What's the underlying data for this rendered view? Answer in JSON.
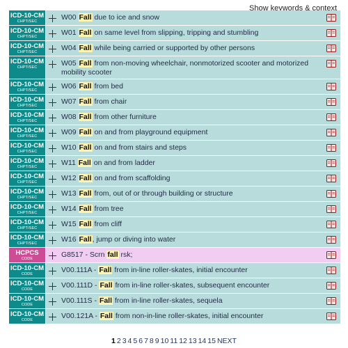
{
  "header": {
    "context_link": "Show keywords & context"
  },
  "colors": {
    "icd_badge": "#0e8a8a",
    "icd_row": "#b8dcdc",
    "hcpcs_badge": "#cc4d95",
    "hcpcs_row": "#f2cdf2",
    "keyword_highlight": "#fff3b0"
  },
  "rows": [
    {
      "system": "ICD-10-CM",
      "sub": "CHPT/SEC",
      "kind": "cm",
      "pre": "W00 ",
      "kw": "Fall",
      "post": " due to ice and snow"
    },
    {
      "system": "ICD-10-CM",
      "sub": "CHPT/SEC",
      "kind": "cm",
      "pre": "W01 ",
      "kw": "Fall",
      "post": " on same level from slipping, tripping and stumbling"
    },
    {
      "system": "ICD-10-CM",
      "sub": "CHPT/SEC",
      "kind": "cm",
      "pre": "W04 ",
      "kw": "Fall",
      "post": " while being carried or supported by other persons"
    },
    {
      "system": "ICD-10-CM",
      "sub": "CHPT/SEC",
      "kind": "cm",
      "pre": "W05 ",
      "kw": "Fall",
      "post": " from non-moving wheelchair, nonmotorized scooter and motorized mobility scooter"
    },
    {
      "system": "ICD-10-CM",
      "sub": "CHPT/SEC",
      "kind": "cm",
      "pre": "W06 ",
      "kw": "Fall",
      "post": " from bed"
    },
    {
      "system": "ICD-10-CM",
      "sub": "CHPT/SEC",
      "kind": "cm",
      "pre": "W07 ",
      "kw": "Fall",
      "post": " from chair"
    },
    {
      "system": "ICD-10-CM",
      "sub": "CHPT/SEC",
      "kind": "cm",
      "pre": "W08 ",
      "kw": "Fall",
      "post": " from other furniture"
    },
    {
      "system": "ICD-10-CM",
      "sub": "CHPT/SEC",
      "kind": "cm",
      "pre": "W09 ",
      "kw": "Fall",
      "post": " on and from playground equipment"
    },
    {
      "system": "ICD-10-CM",
      "sub": "CHPT/SEC",
      "kind": "cm",
      "pre": "W10 ",
      "kw": "Fall",
      "post": " on and from stairs and steps"
    },
    {
      "system": "ICD-10-CM",
      "sub": "CHPT/SEC",
      "kind": "cm",
      "pre": "W11 ",
      "kw": "Fall",
      "post": " on and from ladder"
    },
    {
      "system": "ICD-10-CM",
      "sub": "CHPT/SEC",
      "kind": "cm",
      "pre": "W12 ",
      "kw": "Fall",
      "post": " on and from scaffolding"
    },
    {
      "system": "ICD-10-CM",
      "sub": "CHPT/SEC",
      "kind": "cm",
      "pre": "W13 ",
      "kw": "Fall",
      "post": " from, out of or through building or structure"
    },
    {
      "system": "ICD-10-CM",
      "sub": "CHPT/SEC",
      "kind": "cm",
      "pre": "W14 ",
      "kw": "Fall",
      "post": " from tree"
    },
    {
      "system": "ICD-10-CM",
      "sub": "CHPT/SEC",
      "kind": "cm",
      "pre": "W15 ",
      "kw": "Fall",
      "post": " from cliff"
    },
    {
      "system": "ICD-10-CM",
      "sub": "CHPT/SEC",
      "kind": "cm",
      "pre": "W16 ",
      "kw": "Fall",
      "post": ", jump or diving into water"
    },
    {
      "system": "HCPCS",
      "sub": "CODE",
      "kind": "hc",
      "pre": "G8517 - Scrn ",
      "kw": "fall",
      "post": " rsk;"
    },
    {
      "system": "ICD-10-CM",
      "sub": "CODE",
      "kind": "cm",
      "pre": "V00.111A - ",
      "kw": "Fall",
      "post": " from in-line roller-skates, initial encounter"
    },
    {
      "system": "ICD-10-CM",
      "sub": "CODE",
      "kind": "cm",
      "pre": "V00.111D - ",
      "kw": "Fall",
      "post": " from in-line roller-skates, subsequent encounter"
    },
    {
      "system": "ICD-10-CM",
      "sub": "CODE",
      "kind": "cm",
      "pre": "V00.111S - ",
      "kw": "Fall",
      "post": " from in-line roller-skates, sequela"
    },
    {
      "system": "ICD-10-CM",
      "sub": "CODE",
      "kind": "cm",
      "pre": "V00.121A - ",
      "kw": "Fall",
      "post": " from non-in-line roller-skates, initial encounter"
    }
  ],
  "pagination": {
    "current": "1",
    "pages": [
      "2",
      "3",
      "4",
      "5",
      "6",
      "7",
      "8",
      "9",
      "10",
      "11",
      "12",
      "13",
      "14",
      "15"
    ],
    "next_label": "NEXT"
  }
}
